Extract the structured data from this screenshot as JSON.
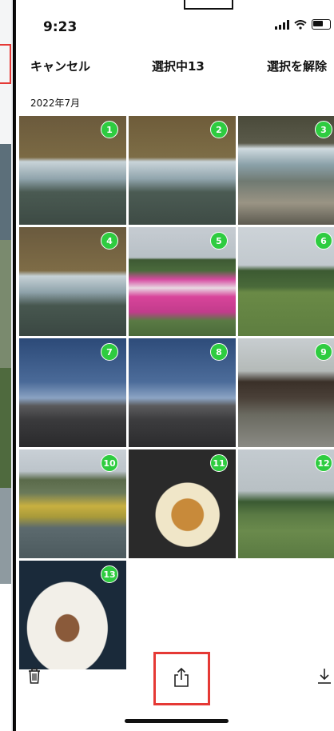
{
  "status": {
    "time": "9:23"
  },
  "nav": {
    "cancel_label": "キャンセル",
    "title": "選択中13",
    "deselect_label": "選択を解除"
  },
  "section": {
    "date_label": "2022年7月"
  },
  "photos": [
    {
      "index": "1",
      "subject": "waterfall"
    },
    {
      "index": "2",
      "subject": "waterfall"
    },
    {
      "index": "3",
      "subject": "waterfall-rocks"
    },
    {
      "index": "4",
      "subject": "waterfall"
    },
    {
      "index": "5",
      "subject": "pink-flower-field"
    },
    {
      "index": "6",
      "subject": "park-lawn"
    },
    {
      "index": "7",
      "subject": "town-sea-view"
    },
    {
      "index": "8",
      "subject": "town-sea-view"
    },
    {
      "index": "9",
      "subject": "wooden-cabin"
    },
    {
      "index": "10",
      "subject": "boats-on-lake"
    },
    {
      "index": "11",
      "subject": "burger-and-fries"
    },
    {
      "index": "12",
      "subject": "park-trees"
    },
    {
      "index": "13",
      "subject": "plated-dish"
    }
  ],
  "toolbar": {
    "icons": [
      "trash-icon",
      "share-icon",
      "download-icon"
    ]
  },
  "colors": {
    "selection_badge": "#2ecc40",
    "highlight": "#e53935"
  }
}
